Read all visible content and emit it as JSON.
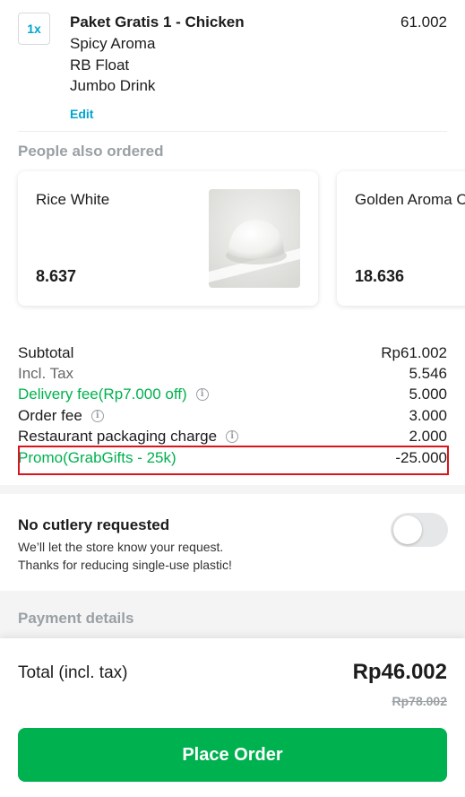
{
  "cart_item": {
    "quantity": "1x",
    "title": "Paket Gratis 1 - Chicken",
    "price": "61.002",
    "options": [
      "Spicy Aroma",
      "RB Float",
      "Jumbo Drink"
    ],
    "edit_label": "Edit"
  },
  "recommendations": {
    "title": "People also ordered",
    "items": [
      {
        "name": "Rice White",
        "price": "8.637"
      },
      {
        "name": "Golden Aroma C",
        "price": "18.636"
      }
    ]
  },
  "breakdown": {
    "subtotal": {
      "label": "Subtotal",
      "value": "Rp61.002"
    },
    "tax": {
      "label": "Incl. Tax",
      "value": "5.546"
    },
    "delivery": {
      "label": "Delivery fee(Rp7.000 off)",
      "value": "5.000"
    },
    "order_fee": {
      "label": "Order fee",
      "value": "3.000"
    },
    "packaging": {
      "label": "Restaurant packaging charge",
      "value": "2.000"
    },
    "promo": {
      "label": "Promo(GrabGifts - 25k)",
      "value": "-25.000"
    }
  },
  "cutlery": {
    "title": "No cutlery requested",
    "desc1": "We’ll let the store know your request.",
    "desc2": "Thanks for reducing single-use plastic!",
    "toggle_on": false
  },
  "payment": {
    "title": "Payment details"
  },
  "footer": {
    "total_label": "Total (incl. tax)",
    "total_value": "Rp46.002",
    "total_original": "Rp78.002",
    "place_order_label": "Place Order"
  },
  "colors": {
    "accent_green": "#00b14f",
    "link_blue": "#00a5cf",
    "highlight_red": "#d8151d"
  },
  "icons": [
    "info-icon",
    "rice-image"
  ]
}
